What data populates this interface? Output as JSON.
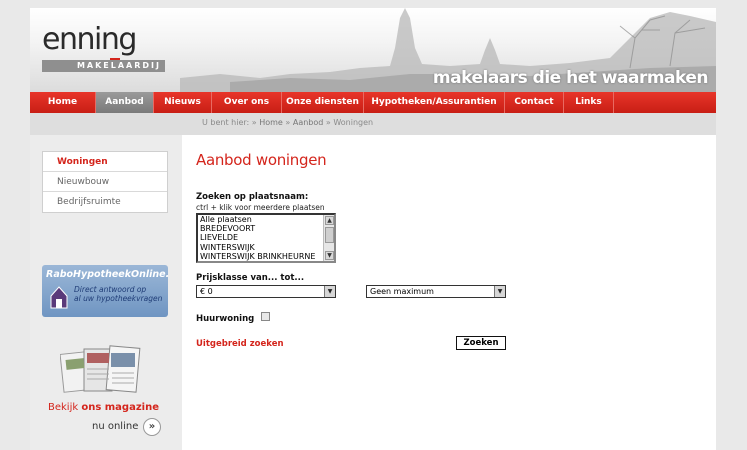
{
  "logo": {
    "word": "enning",
    "sub": "MAKELAARDIJ"
  },
  "tagline": "makelaars die het waarmaken",
  "nav": [
    {
      "label": "Home",
      "active": false
    },
    {
      "label": "Aanbod",
      "active": true
    },
    {
      "label": "Nieuws",
      "active": false
    },
    {
      "label": "Over ons",
      "active": false
    },
    {
      "label": "Onze diensten",
      "active": false
    },
    {
      "label": "Hypotheken/Assurantien",
      "active": false
    },
    {
      "label": "Contact",
      "active": false
    },
    {
      "label": "Links",
      "active": false
    }
  ],
  "breadcrumb": {
    "prefix": "U bent hier:",
    "sep": "»",
    "items": [
      "Home",
      "Aanbod",
      "Woningen"
    ]
  },
  "sidebar": {
    "items": [
      {
        "label": "Woningen",
        "active": true
      },
      {
        "label": "Nieuwbouw",
        "active": false
      },
      {
        "label": "Bedrijfsruimte",
        "active": false
      }
    ],
    "rabo": {
      "title": "RaboHypotheekOnline.nl",
      "line1": "Direct antwoord op",
      "line2": "al uw hypotheekvragen"
    },
    "magazine": {
      "prefix": "Bekijk ",
      "bold": "ons magazine",
      "line2": "nu online",
      "arrow": "»"
    }
  },
  "main": {
    "heading": "Aanbod woningen",
    "search_label": "Zoeken op plaatsnaam:",
    "hint": "ctrl + klik voor meerdere plaatsen",
    "places": [
      "Alle plaatsen",
      "BREDEVOORT",
      "LIEVELDE",
      "WINTERSWIJK",
      "WINTERSWIJK BRINKHEURNE"
    ],
    "price_label": "Prijsklasse van... tot...",
    "price_from": "€ 0",
    "price_to": "Geen maximum",
    "rent_label": "Huurwoning",
    "advanced_link": "Uitgebreid zoeken",
    "search_button": "Zoeken"
  },
  "colors": {
    "accent": "#d4251c",
    "nav_active": "#8a8a8a",
    "background": "#e9e9e9"
  }
}
